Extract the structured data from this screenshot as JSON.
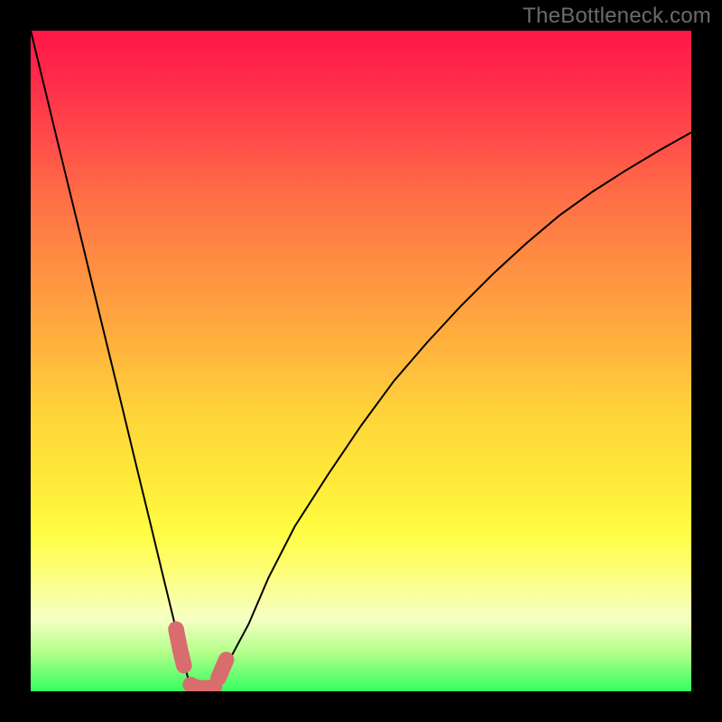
{
  "watermark": "TheBottleneck.com",
  "colors": {
    "frame": "#000000",
    "curve": "#000000",
    "highlight": "#d96c6c",
    "watermark": "#6b6b6b"
  },
  "chart_data": {
    "type": "line",
    "title": "",
    "xlabel": "",
    "ylabel": "",
    "xlim": [
      0,
      100
    ],
    "ylim": [
      0,
      100
    ],
    "x": [
      0,
      2,
      4,
      6,
      8,
      10,
      12,
      14,
      16,
      18,
      20,
      22,
      23,
      24,
      25,
      26,
      27,
      28,
      30,
      33,
      36,
      40,
      45,
      50,
      55,
      60,
      65,
      70,
      75,
      80,
      85,
      90,
      95,
      100
    ],
    "values": [
      100.0,
      91.8,
      83.5,
      75.3,
      67.1,
      58.8,
      50.6,
      42.4,
      34.1,
      25.9,
      17.6,
      9.4,
      5.3,
      1.2,
      0.6,
      0.5,
      0.5,
      0.7,
      4.6,
      10.2,
      17.2,
      25.0,
      32.8,
      40.2,
      47.0,
      52.8,
      58.2,
      63.2,
      67.8,
      72.0,
      75.6,
      78.8,
      81.8,
      84.6
    ],
    "highlight_segments": [
      {
        "x": [
          22.0,
          22.6,
          23.2
        ],
        "y": [
          9.4,
          6.4,
          3.9
        ]
      },
      {
        "x": [
          24.2,
          25.0,
          26.0,
          27.0,
          27.8
        ],
        "y": [
          1.0,
          0.6,
          0.5,
          0.5,
          0.7
        ]
      },
      {
        "x": [
          28.4,
          29.0,
          29.6
        ],
        "y": [
          2.0,
          3.4,
          4.8
        ]
      }
    ],
    "grid": false,
    "legend": false
  }
}
